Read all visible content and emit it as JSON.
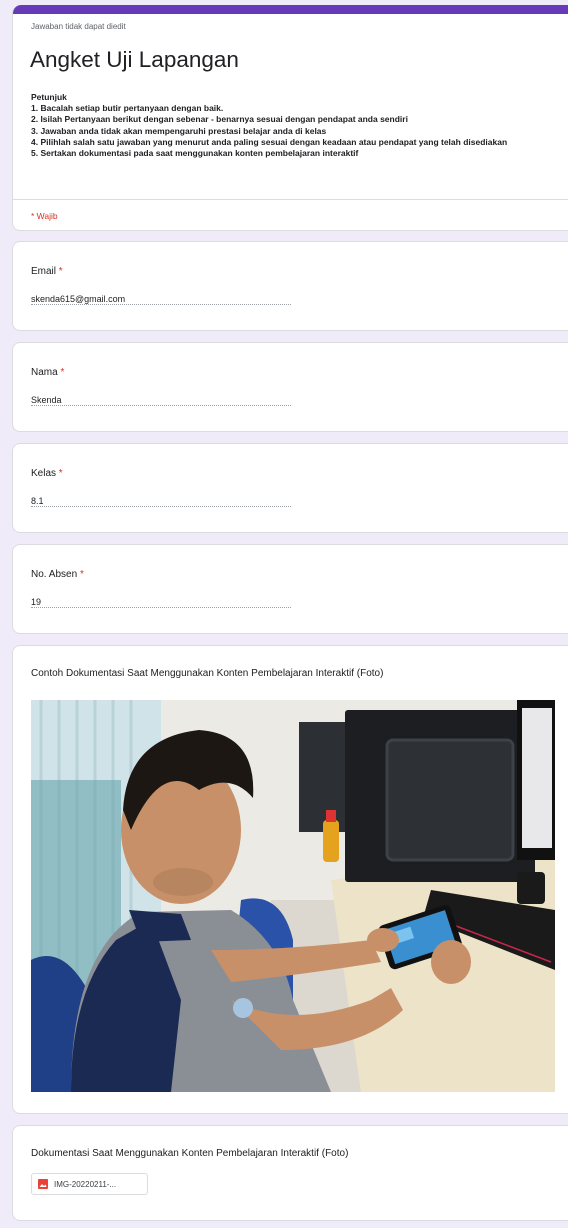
{
  "header": {
    "notice": "Jawaban tidak dapat diedit",
    "title": "Angket Uji Lapangan",
    "description_title": "Petunjuk",
    "instructions": [
      "1. Bacalah setiap butir pertanyaan dengan baik.",
      "2. Isilah Pertanyaan berikut dengan sebenar - benarnya sesuai dengan pendapat anda sendiri",
      "3. Jawaban anda tidak akan mempengaruhi prestasi belajar anda di kelas",
      "4. Pilihlah salah satu jawaban yang menurut anda paling sesuai dengan keadaan atau pendapat yang telah disediakan",
      "5. Sertakan dokumentasi pada saat menggunakan konten pembelajaran interaktif"
    ],
    "required_note": "* Wajib"
  },
  "questions": [
    {
      "label": "Email",
      "required": "*",
      "value": "skenda615@gmail.com"
    },
    {
      "label": "Nama",
      "required": "*",
      "value": "Skenda"
    },
    {
      "label": "Kelas",
      "required": "*",
      "value": "8.1"
    },
    {
      "label": "No. Absen",
      "required": "*",
      "value": "19"
    }
  ],
  "example_photo": {
    "label": "Contoh Dokumentasi Saat Menggunakan Konten Pembelajaran Interaktif (Foto)"
  },
  "upload": {
    "label": "Dokumentasi Saat Menggunakan Konten Pembelajaran Interaktif (Foto)",
    "file_name": "IMG-20220211-...",
    "file_icon": "image-file-icon"
  },
  "colors": {
    "accent": "#673ab7",
    "required": "#d93025",
    "background": "#f0ebf8"
  }
}
